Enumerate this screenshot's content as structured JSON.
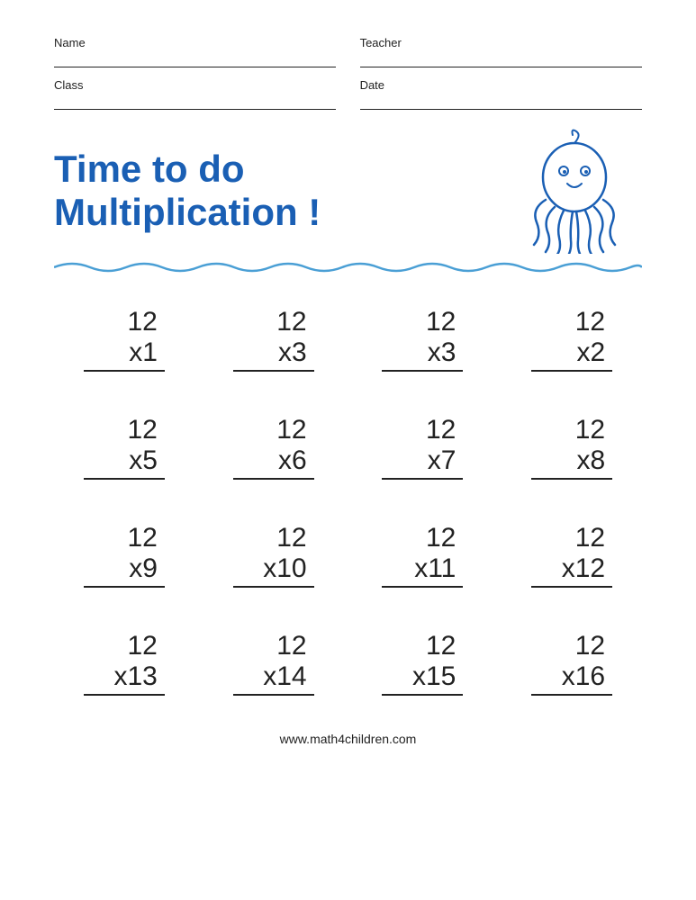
{
  "header": {
    "name_label": "Name",
    "teacher_label": "Teacher",
    "class_label": "Class",
    "date_label": "Date"
  },
  "title": {
    "line1": "Time to do",
    "line2": "Multiplication !"
  },
  "problems": [
    {
      "top": "12",
      "multiplier": "x1"
    },
    {
      "top": "12",
      "multiplier": "x3"
    },
    {
      "top": "12",
      "multiplier": "x3"
    },
    {
      "top": "12",
      "multiplier": "x2"
    },
    {
      "top": "12",
      "multiplier": "x5"
    },
    {
      "top": "12",
      "multiplier": "x6"
    },
    {
      "top": "12",
      "multiplier": "x7"
    },
    {
      "top": "12",
      "multiplier": "x8"
    },
    {
      "top": "12",
      "multiplier": "x9"
    },
    {
      "top": "12",
      "multiplier": "x10"
    },
    {
      "top": "12",
      "multiplier": "x11"
    },
    {
      "top": "12",
      "multiplier": "x12"
    },
    {
      "top": "12",
      "multiplier": "x13"
    },
    {
      "top": "12",
      "multiplier": "x14"
    },
    {
      "top": "12",
      "multiplier": "x15"
    },
    {
      "top": "12",
      "multiplier": "x16"
    }
  ],
  "footer": {
    "url": "www.math4children.com"
  }
}
